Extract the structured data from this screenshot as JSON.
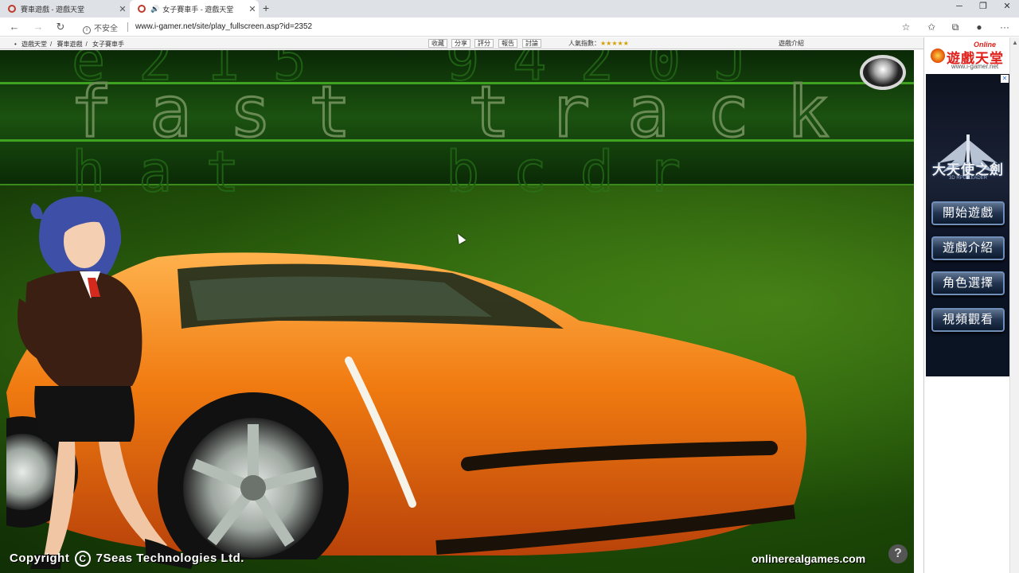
{
  "browser": {
    "tabs": [
      {
        "title": "賽車遊戲 - 遊戲天堂",
        "active": false
      },
      {
        "title": "女子賽車手 - 遊戲天堂",
        "active": true
      }
    ],
    "security_label": "不安全",
    "url": "www.i-gamer.net/site/play_fullscreen.asp?id=2352"
  },
  "site_strip": {
    "breadcrumb": [
      "遊戲天堂",
      "賽車遊戲",
      "女子賽車手"
    ],
    "actions": [
      "收藏",
      "分享",
      "評分",
      "報告",
      "討論"
    ],
    "popularity_label": "人氣指數：",
    "popularity_stars": 5,
    "intro_link": "遊戲介紹"
  },
  "game": {
    "banner_title": [
      "f",
      "a",
      "s",
      "t",
      "t",
      "r",
      "a",
      "c",
      "k"
    ],
    "copyright": "Copyright",
    "copyright_company": "7Seas Technologies Ltd.",
    "site_credit": "onlinerealgames.com",
    "help": "?"
  },
  "sidebar": {
    "logo_online": "Online",
    "logo_name": "遊戲天堂",
    "logo_domain": "www.i-gamer.net",
    "ad_game_title": "大天使之劍",
    "ad_game_sub": "3D RPG LEADER",
    "buttons": [
      "開始遊戲",
      "遊戲介紹",
      "角色選擇",
      "視頻觀看"
    ]
  }
}
